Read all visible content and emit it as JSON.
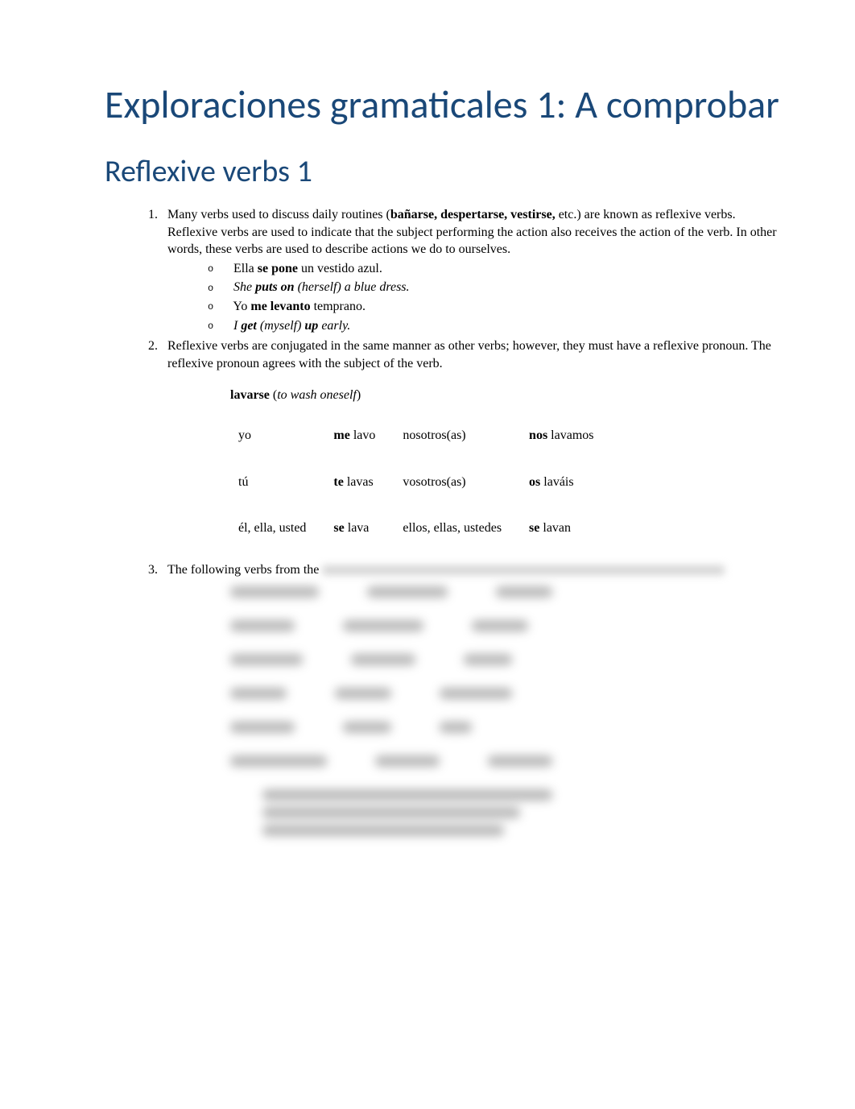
{
  "title": "Exploraciones gramaticales 1: A comprobar",
  "subtitle": "Reflexive verbs 1",
  "list": {
    "item1": {
      "intro_a": "Many verbs used to discuss daily routines (",
      "bold_verbs": "bañarse, despertarse, vestirse,",
      "intro_b": " etc.) are known as reflexive verbs. Reflexive verbs are used to indicate that the subject performing the action also receives the action of the verb. In other words, these verbs are used to describe actions we do to ourselves.",
      "ex1_a": "Ella ",
      "ex1_bold": "se pone",
      "ex1_b": " un vestido azul.",
      "ex2_a": "She ",
      "ex2_bold": "puts on",
      "ex2_b": " (herself) a blue dress.",
      "ex3_a": "Yo ",
      "ex3_bold": "me levanto",
      "ex3_b": " temprano.",
      "ex4_a": "I ",
      "ex4_bold_a": "get",
      "ex4_mid": " (myself) ",
      "ex4_bold_b": "up",
      "ex4_b": " early."
    },
    "item2": "Reflexive verbs are conjugated in the same manner as other verbs; however, they must have a reflexive pronoun. The reflexive pronoun agrees with the subject of the verb.",
    "item3": "The following verbs from the "
  },
  "table": {
    "caption_bold": "lavarse",
    "caption_paren": " (",
    "caption_italic": "to wash oneself",
    "caption_close": ")",
    "rows": [
      {
        "s1": "yo",
        "p1a": "me",
        "p1b": " lavo",
        "s2": "nosotros(as)",
        "p2a": "nos",
        "p2b": " lavamos"
      },
      {
        "s1": "tú",
        "p1a": "te",
        "p1b": " lavas",
        "s2": "vosotros(as)",
        "p2a": "os",
        "p2b": " laváis"
      },
      {
        "s1": "él, ella, usted",
        "p1a": "se",
        "p1b": " lava",
        "s2": "ellos, ellas, ustedes",
        "p2a": "se",
        "p2b": " lavan"
      }
    ]
  }
}
